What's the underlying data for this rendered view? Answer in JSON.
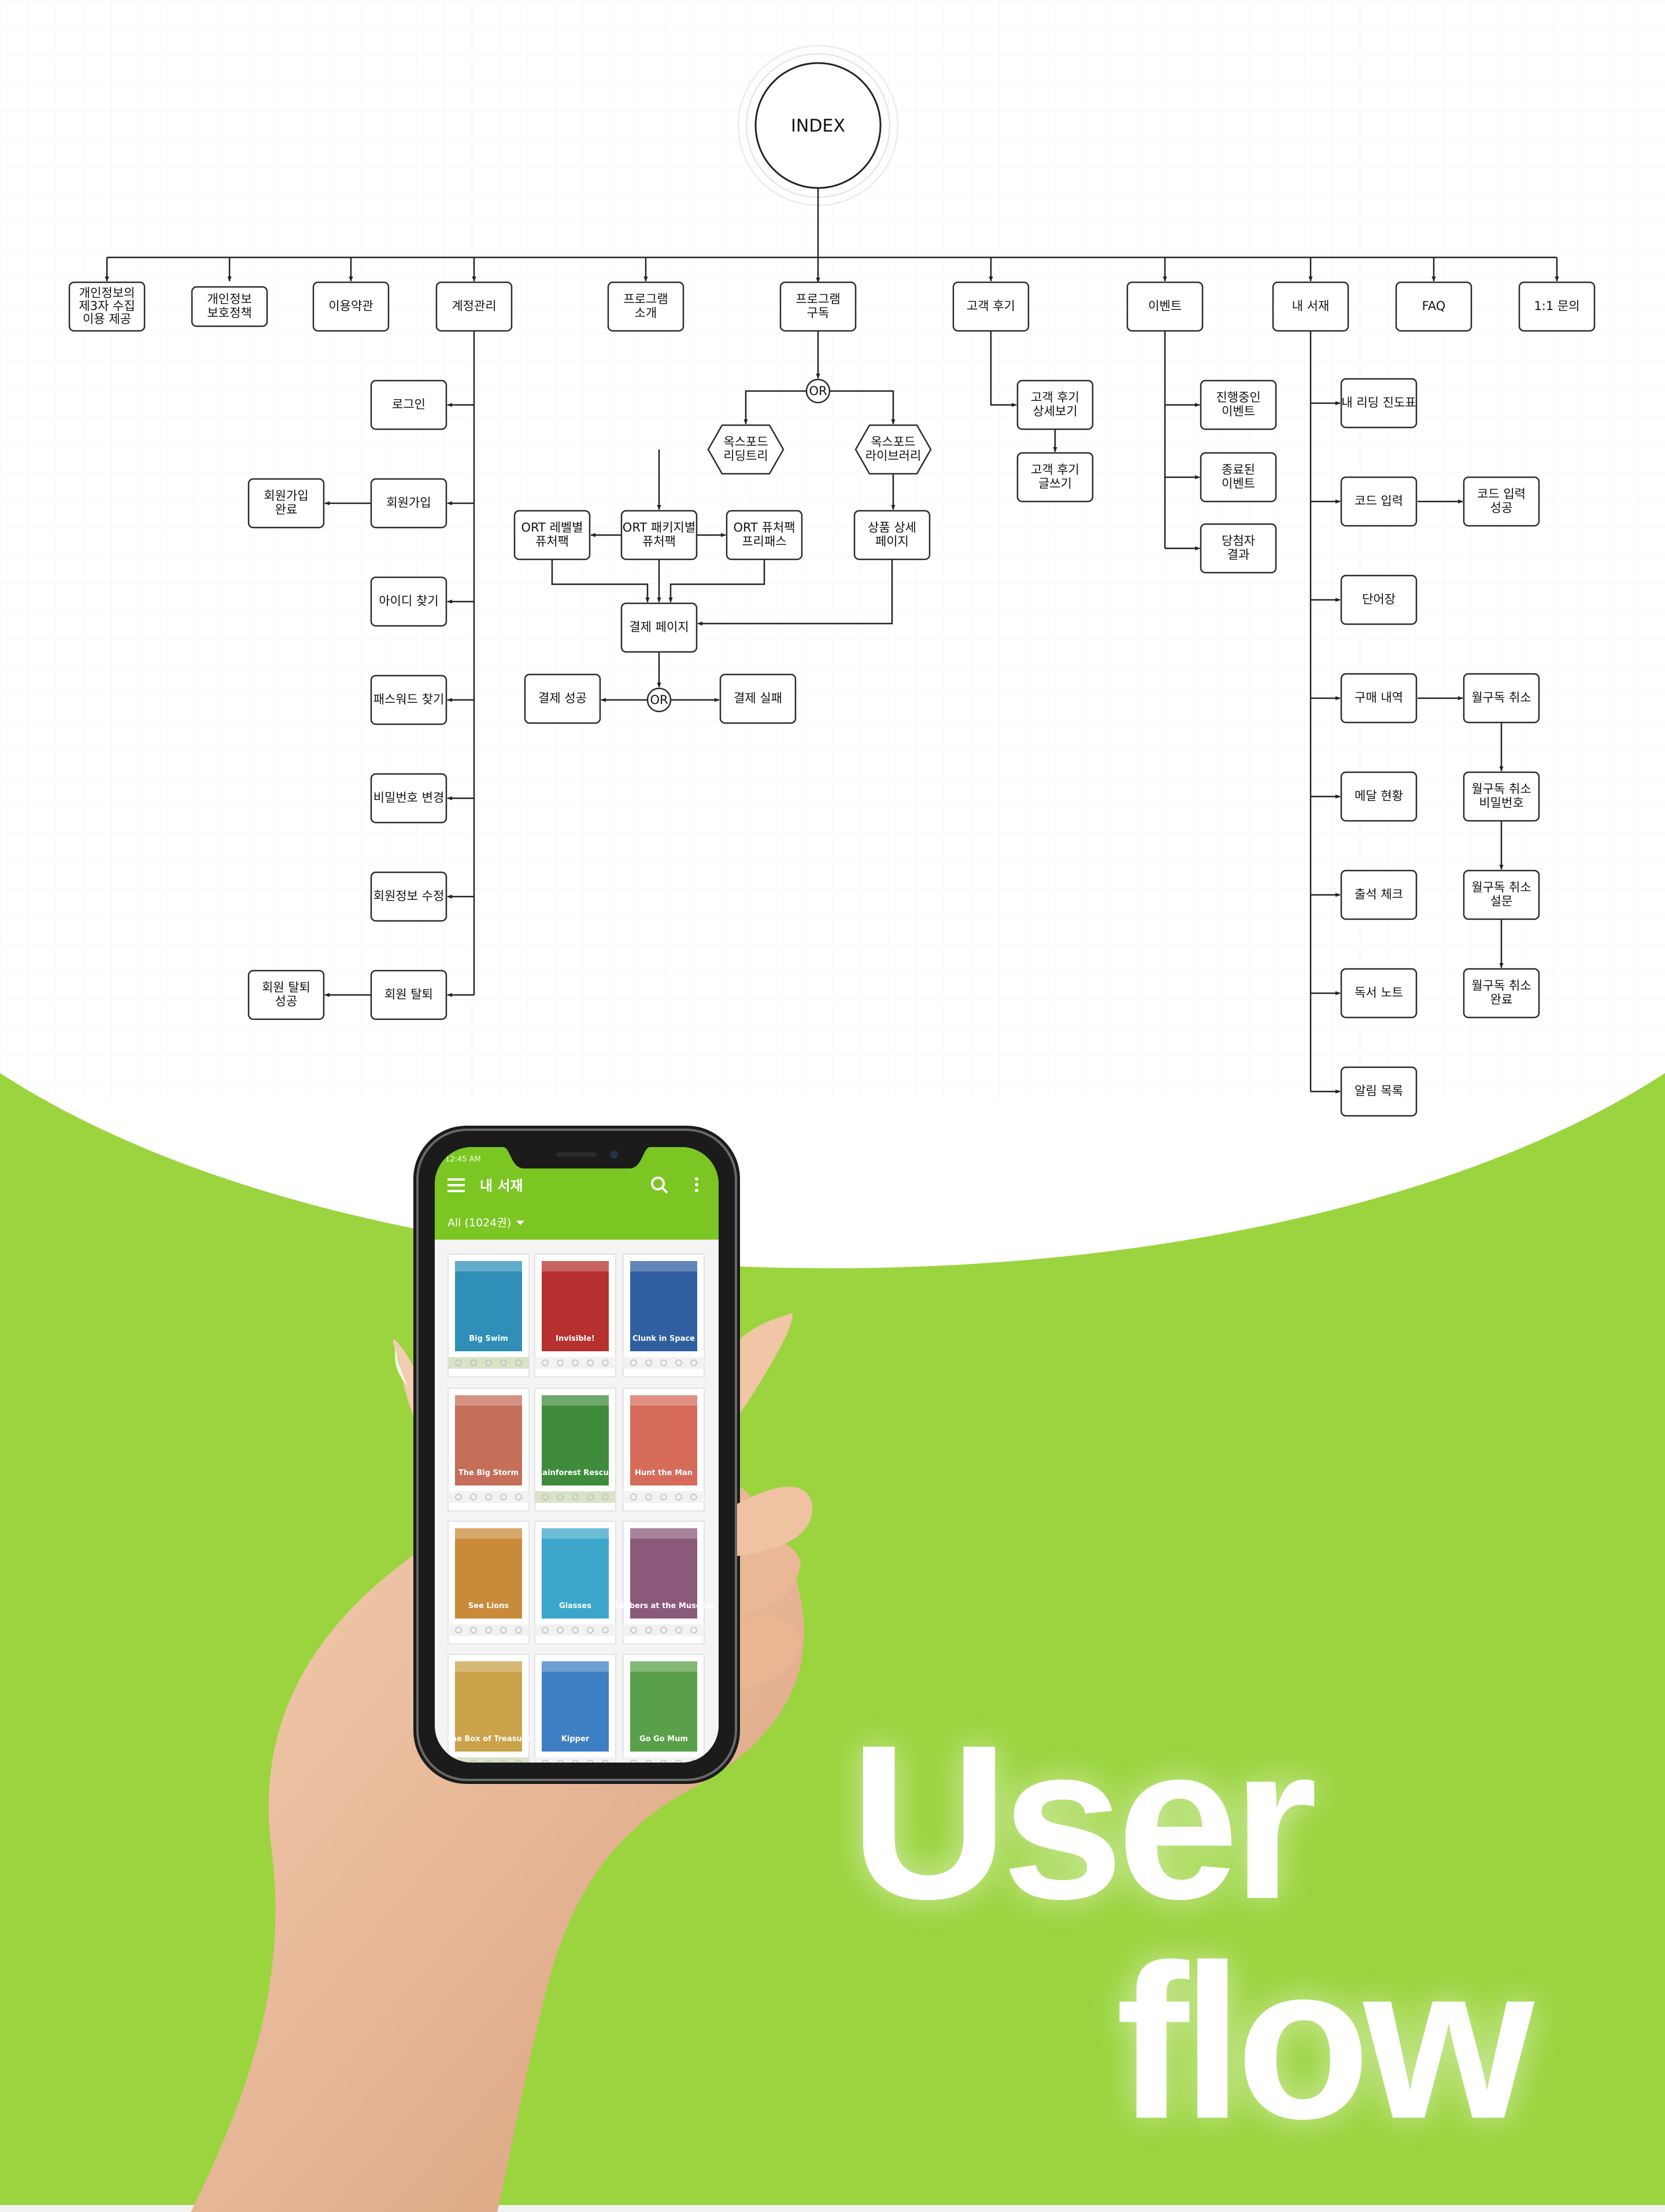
{
  "colors": {
    "accent_green": "#9bd43f",
    "app_green": "#7cc623",
    "line": "#222222"
  },
  "index": {
    "label": "INDEX"
  },
  "top_nodes": [
    {
      "id": "privacy3",
      "lines": [
        "개인정보의",
        "제3자 수집",
        "이용 제공"
      ]
    },
    {
      "id": "privacy",
      "lines": [
        "개인정보",
        "보호정책"
      ]
    },
    {
      "id": "terms",
      "lines": [
        "이용약관"
      ]
    },
    {
      "id": "account",
      "lines": [
        "계정관리"
      ]
    },
    {
      "id": "program-intro",
      "lines": [
        "프로그램",
        "소개"
      ]
    },
    {
      "id": "program-sub",
      "lines": [
        "프로그램",
        "구독"
      ]
    },
    {
      "id": "reviews",
      "lines": [
        "고객 후기"
      ]
    },
    {
      "id": "events",
      "lines": [
        "이벤트"
      ]
    },
    {
      "id": "my-library",
      "lines": [
        "내 서재"
      ]
    },
    {
      "id": "faq",
      "lines": [
        "FAQ"
      ]
    },
    {
      "id": "inquiry",
      "lines": [
        "1:1 문의"
      ]
    }
  ],
  "account_nodes": [
    {
      "id": "login",
      "lines": [
        "로그인"
      ]
    },
    {
      "id": "signup",
      "lines": [
        "회원가입"
      ]
    },
    {
      "id": "find-id",
      "lines": [
        "아이디 찾기"
      ]
    },
    {
      "id": "find-pw",
      "lines": [
        "패스워드 찾기"
      ]
    },
    {
      "id": "change-pw",
      "lines": [
        "비밀번호 변경"
      ]
    },
    {
      "id": "edit-info",
      "lines": [
        "회원정보 수정"
      ]
    },
    {
      "id": "withdraw",
      "lines": [
        "회원 탈퇴"
      ]
    }
  ],
  "account_side_nodes": [
    {
      "id": "signup-done",
      "lines": [
        "회원가입",
        "완료"
      ]
    },
    {
      "id": "withdraw-done",
      "lines": [
        "회원 탈퇴",
        "성공"
      ]
    }
  ],
  "program_nodes": [
    {
      "id": "or1",
      "lines": [
        "OR"
      ]
    },
    {
      "id": "oxford-tree",
      "lines": [
        "옥스포드",
        "리딩트리"
      ]
    },
    {
      "id": "oxford-lib",
      "lines": [
        "옥스포드",
        "라이브러리"
      ]
    },
    {
      "id": "ort-level",
      "lines": [
        "ORT 레벨별",
        "퓨처팩"
      ]
    },
    {
      "id": "ort-package",
      "lines": [
        "ORT 패키지별",
        "퓨처팩"
      ]
    },
    {
      "id": "ort-pass",
      "lines": [
        "ORT 퓨처팩",
        "프리패스"
      ]
    },
    {
      "id": "product-detail",
      "lines": [
        "상품 상세",
        "페이지"
      ]
    },
    {
      "id": "payment",
      "lines": [
        "결제 페이지"
      ]
    },
    {
      "id": "or2",
      "lines": [
        "OR"
      ]
    },
    {
      "id": "pay-ok",
      "lines": [
        "결제 성공"
      ]
    },
    {
      "id": "pay-fail",
      "lines": [
        "결제 실패"
      ]
    }
  ],
  "review_nodes": [
    {
      "id": "review-detail",
      "lines": [
        "고객 후기",
        "상세보기"
      ]
    },
    {
      "id": "review-write",
      "lines": [
        "고객 후기",
        "글쓰기"
      ]
    }
  ],
  "event_nodes": [
    {
      "id": "event-ongoing",
      "lines": [
        "진행중인",
        "이벤트"
      ]
    },
    {
      "id": "event-ended",
      "lines": [
        "종료된",
        "이벤트"
      ]
    },
    {
      "id": "event-winners",
      "lines": [
        "당첨자",
        "결과"
      ]
    }
  ],
  "library_nodes": [
    {
      "id": "progress",
      "lines": [
        "내 리딩 진도표"
      ]
    },
    {
      "id": "code-input",
      "lines": [
        "코드 입력"
      ]
    },
    {
      "id": "vocab",
      "lines": [
        "단어장"
      ]
    },
    {
      "id": "purchases",
      "lines": [
        "구매 내역"
      ]
    },
    {
      "id": "medals",
      "lines": [
        "메달 현황"
      ]
    },
    {
      "id": "attendance",
      "lines": [
        "출석 체크"
      ]
    },
    {
      "id": "reading-note",
      "lines": [
        "독서 노트"
      ]
    },
    {
      "id": "notifications",
      "lines": [
        "알림 목록"
      ]
    }
  ],
  "library_side_nodes": [
    {
      "id": "code-ok",
      "lines": [
        "코드 입력",
        "성공"
      ]
    },
    {
      "id": "cancel-sub",
      "lines": [
        "월구독 취소"
      ]
    },
    {
      "id": "cancel-pw",
      "lines": [
        "월구독 취소",
        "비밀번호"
      ]
    },
    {
      "id": "cancel-survey",
      "lines": [
        "월구독 취소",
        "설문"
      ]
    },
    {
      "id": "cancel-done",
      "lines": [
        "월구독 취소",
        "완료"
      ]
    }
  ],
  "phone": {
    "status_time": "12:45 AM",
    "title": "내 서재",
    "filter": "All (1024권)",
    "books": [
      "Big Swim",
      "Invisible!",
      "Clunk in Space",
      "The Big Storm",
      "Rainforest Rescue",
      "Hunt the Man",
      "See Lions",
      "Glasses",
      "Robbers at the Museum",
      "The Box of Treasure",
      "Kipper",
      "Go Go Mum"
    ]
  },
  "title": {
    "line1": "User",
    "line2": "flow"
  }
}
